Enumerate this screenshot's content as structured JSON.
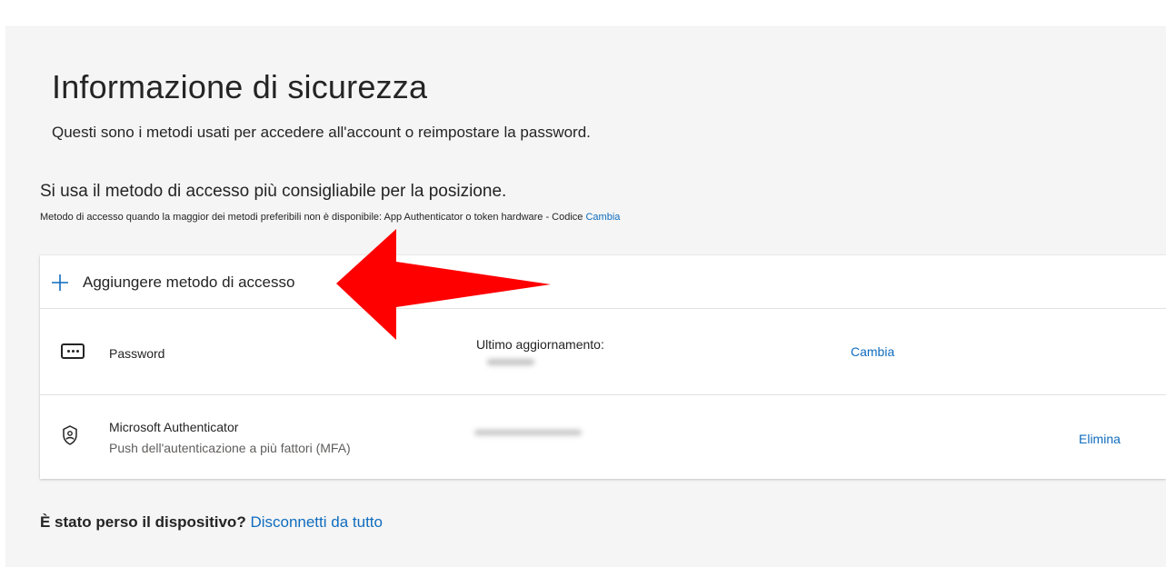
{
  "page": {
    "title": "Informazione di sicurezza",
    "subtitle": "Questi sono i metodi usati per accedere all'account o reimpostare la password."
  },
  "default_method": {
    "heading": "Si usa il metodo di accesso più consigliabile per la posizione.",
    "note": "Metodo di accesso quando la maggior dei metodi preferibili non è disponibile: App Authenticator o token hardware - Codice",
    "change_link": "Cambia"
  },
  "methods_card": {
    "add_label": "Aggiungere metodo di accesso",
    "add_icon": "plus-icon",
    "rows": [
      {
        "icon": "password-dots-icon",
        "name": "Password",
        "updated_label": "Ultimo aggiornamento:",
        "action": "Cambia"
      },
      {
        "icon": "authenticator-icon",
        "name": "Microsoft Authenticator",
        "detail": "Push dell'autenticazione a più fattori (MFA)",
        "action": "Elimina"
      }
    ]
  },
  "lost_device": {
    "question": "È stato perso il dispositivo?",
    "link": "Disconnetti da tutto"
  },
  "colors": {
    "link": "#0f6cbd",
    "annotation_arrow": "#ff0000",
    "page_background": "#f5f5f5"
  }
}
